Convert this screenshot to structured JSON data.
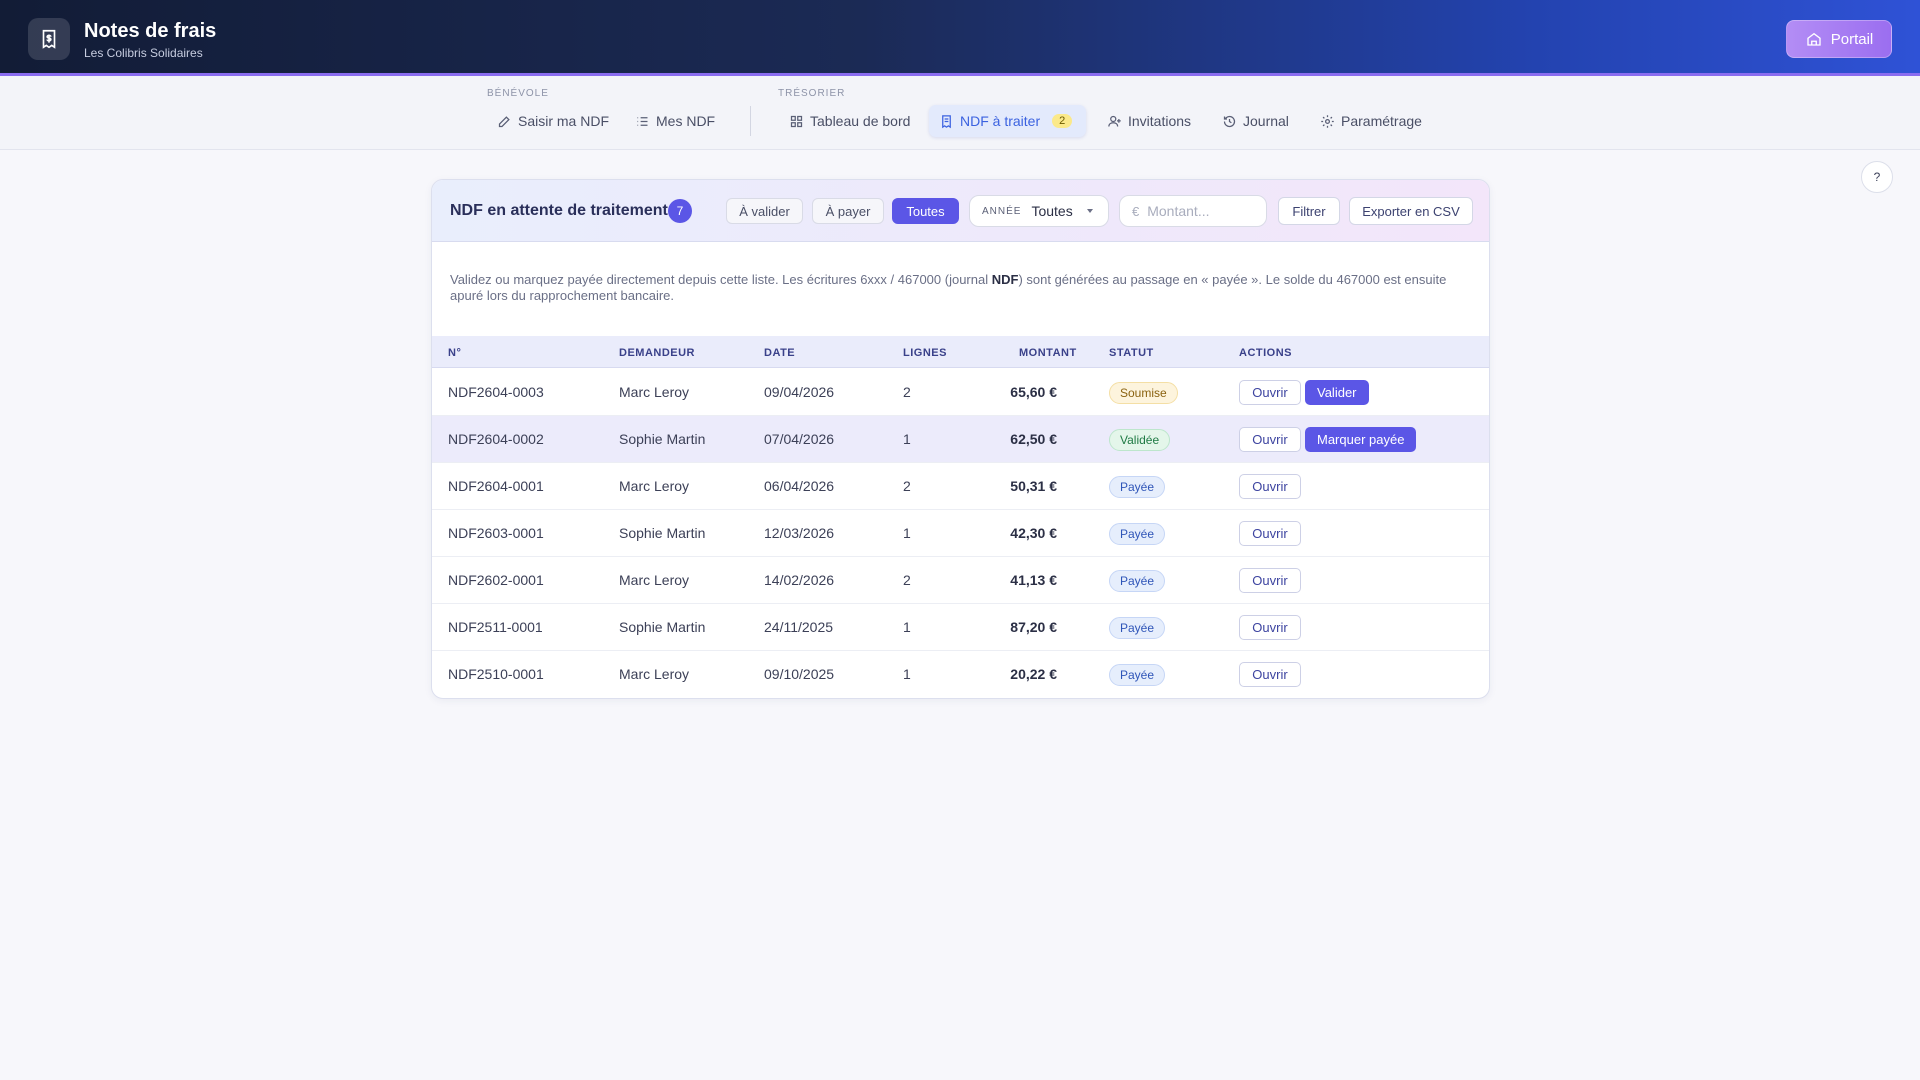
{
  "header": {
    "title": "Notes de frais",
    "subtitle": "Les Colibris Solidaires",
    "portal_label": "Portail"
  },
  "nav": {
    "groups": {
      "benevole": "BÉNÉVOLE",
      "tresorier": "TRÉSORIER"
    },
    "items": [
      {
        "label": "Saisir ma NDF",
        "icon": "pen-icon"
      },
      {
        "label": "Mes NDF",
        "icon": "list-icon"
      },
      {
        "label": "Tableau de bord",
        "icon": "grid-icon"
      },
      {
        "label": "NDF à traiter",
        "icon": "receipt-icon",
        "badge": "2",
        "active": true
      },
      {
        "label": "Invitations",
        "icon": "user-plus-icon"
      },
      {
        "label": "Journal",
        "icon": "history-icon"
      },
      {
        "label": "Paramétrage",
        "icon": "gear-icon"
      }
    ],
    "help": "?"
  },
  "card": {
    "title": "NDF en attente de traitement",
    "count": "7",
    "filters": {
      "a_valider": "À valider",
      "a_payer": "À payer",
      "toutes": "Toutes",
      "active": "toutes"
    },
    "year": {
      "label": "ANNÉE",
      "value": "Toutes"
    },
    "amount": {
      "placeholder": "Montant...",
      "symbol": "€"
    },
    "filter_btn": "Filtrer",
    "export_btn": "Exporter en CSV",
    "description_1": "Validez ou marquez payée directement depuis cette liste. Les écritures 6xxx / 467000 (journal ",
    "description_bold": "NDF",
    "description_2": ") sont générées au passage en « payée ». Le solde du 467000 est ensuite apuré lors du rapprochement bancaire."
  },
  "table": {
    "columns": {
      "num": "N°",
      "requester": "DEMANDEUR",
      "date": "DATE",
      "lines": "LIGNES",
      "amount": "MONTANT",
      "status": "STATUT",
      "actions": "ACTIONS"
    },
    "open_label": "Ouvrir",
    "rows": [
      {
        "num": "NDF2604-0003",
        "requester": "Marc Leroy",
        "date": "09/04/2026",
        "lines": "2",
        "amount": "65,60 €",
        "status": "Soumise",
        "action": "Valider"
      },
      {
        "num": "NDF2604-0002",
        "requester": "Sophie Martin",
        "date": "07/04/2026",
        "lines": "1",
        "amount": "62,50 €",
        "status": "Validée",
        "action": "Marquer payée"
      },
      {
        "num": "NDF2604-0001",
        "requester": "Marc Leroy",
        "date": "06/04/2026",
        "lines": "2",
        "amount": "50,31 €",
        "status": "Payée"
      },
      {
        "num": "NDF2603-0001",
        "requester": "Sophie Martin",
        "date": "12/03/2026",
        "lines": "1",
        "amount": "42,30 €",
        "status": "Payée"
      },
      {
        "num": "NDF2602-0001",
        "requester": "Marc Leroy",
        "date": "14/02/2026",
        "lines": "2",
        "amount": "41,13 €",
        "status": "Payée"
      },
      {
        "num": "NDF2511-0001",
        "requester": "Sophie Martin",
        "date": "24/11/2025",
        "lines": "1",
        "amount": "87,20 €",
        "status": "Payée"
      },
      {
        "num": "NDF2510-0001",
        "requester": "Marc Leroy",
        "date": "09/10/2025",
        "lines": "1",
        "amount": "20,22 €",
        "status": "Payée"
      }
    ]
  }
}
